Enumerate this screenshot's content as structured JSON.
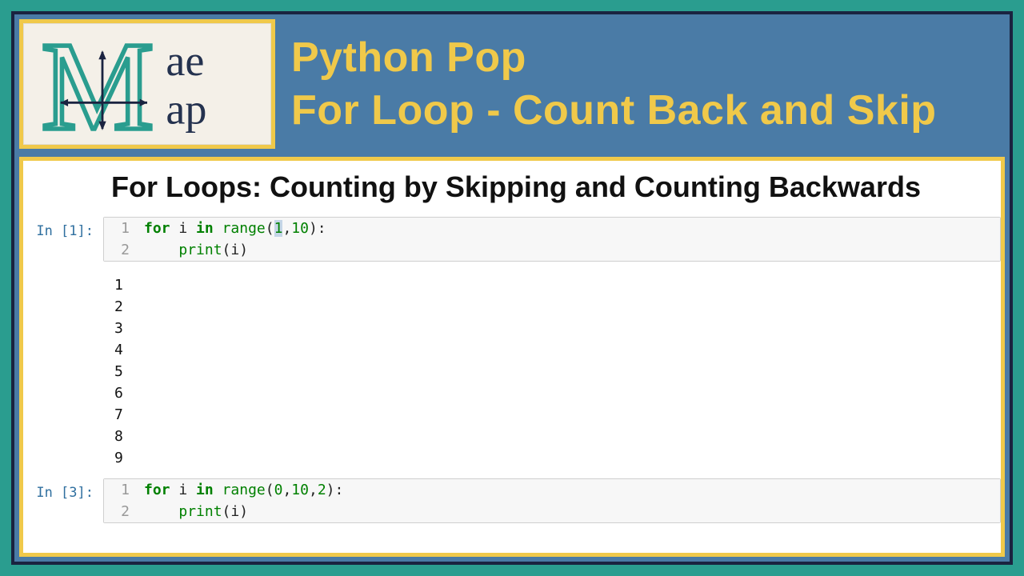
{
  "logo": {
    "top_text": "ae",
    "bottom_text": "ap"
  },
  "header": {
    "line1": "Python Pop",
    "line2": "For Loop - Count Back and Skip"
  },
  "notebook": {
    "heading": "For Loops: Counting by Skipping and Counting Backwards",
    "cell1": {
      "prompt": "In [1]:",
      "ln1": "1",
      "ln2": "2",
      "kw_for": "for",
      "kw_in": "in",
      "var_i": " i ",
      "fn_range": "range",
      "open_p": "(",
      "arg_sel": "1",
      "comma1": ",",
      "arg_b": "10",
      "close_p": "):",
      "indent": "    ",
      "fn_print": "print",
      "print_args": "(i)",
      "output": "1\n2\n3\n4\n5\n6\n7\n8\n9"
    },
    "cell2": {
      "prompt": "In [3]:",
      "ln1": "1",
      "ln2": "2",
      "kw_for": "for",
      "kw_in": "in",
      "var_i": " i ",
      "fn_range": "range",
      "open_p": "(",
      "arg_a": "0",
      "comma1": ",",
      "arg_b": "10",
      "comma2": ",",
      "arg_c": "2",
      "close_p": "):",
      "indent": "    ",
      "fn_print": "print",
      "print_args": "(i)"
    }
  }
}
